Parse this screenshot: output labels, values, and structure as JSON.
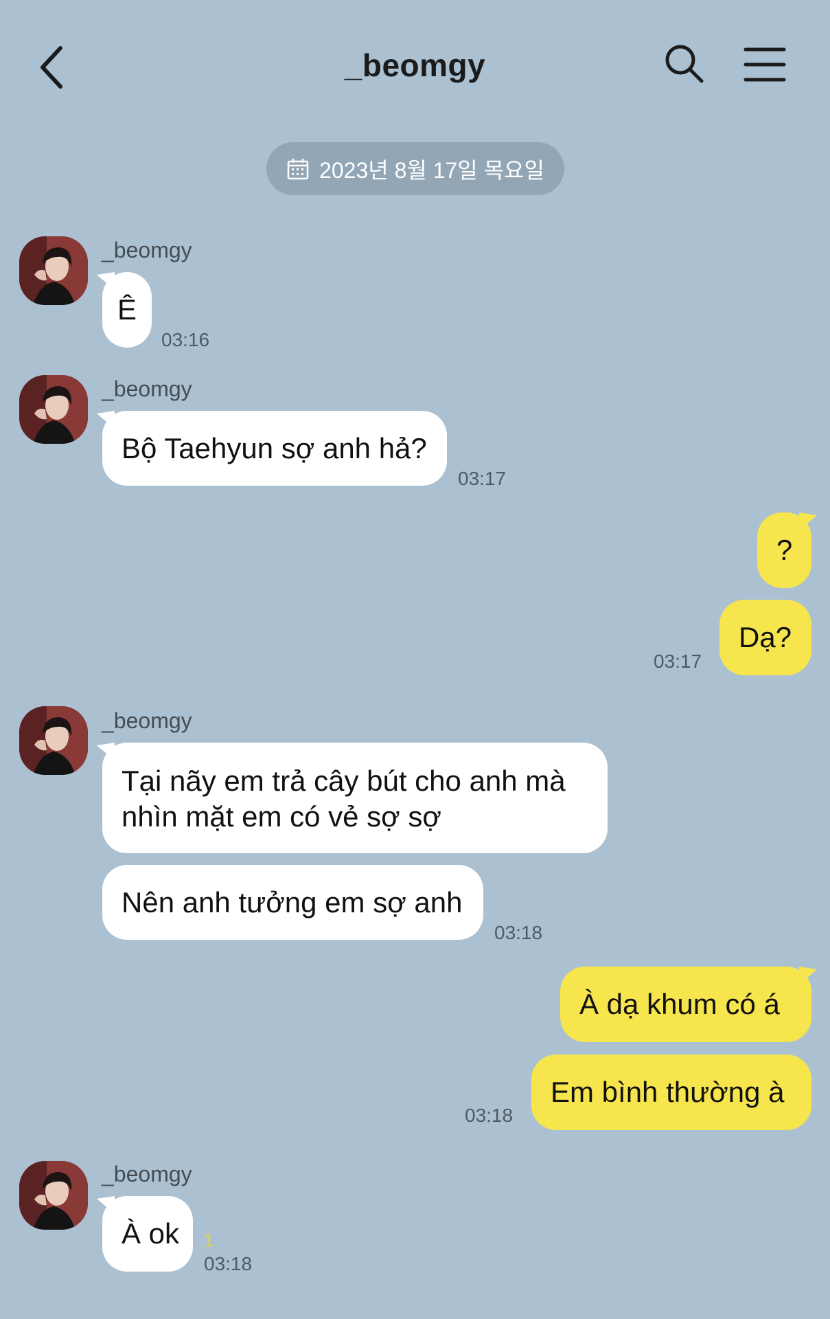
{
  "header": {
    "title": "_beomgy",
    "back_icon": "chevron-left-icon",
    "search_icon": "search-icon",
    "menu_icon": "hamburger-menu-icon"
  },
  "date_separator": {
    "icon": "calendar-icon",
    "text": "2023년 8월 17일 목요일"
  },
  "messages": {
    "m1": {
      "sender": "_beomgy",
      "text": "Ê",
      "time": "03:16"
    },
    "m2": {
      "sender": "_beomgy",
      "text": "Bộ Taehyun sợ anh hả?",
      "time": "03:17"
    },
    "m3": {
      "text": "?"
    },
    "m4": {
      "text": "Dạ?",
      "time": "03:17"
    },
    "m5": {
      "sender": "_beomgy",
      "line1": "Tại nãy em trả cây bút cho anh mà",
      "line2": "nhìn mặt em có vẻ sợ sợ"
    },
    "m6": {
      "text": "Nên anh tưởng em sợ anh",
      "time": "03:18"
    },
    "m7": {
      "text": "À dạ khum có á"
    },
    "m8": {
      "text": "Em bình thường à",
      "time": "03:18"
    },
    "m9": {
      "sender": "_beomgy",
      "text": "À ok",
      "unread": "1",
      "time": "03:18"
    }
  },
  "colors": {
    "background": "#abc1d1",
    "incoming_bubble": "#ffffff",
    "outgoing_bubble": "#f6e54c",
    "date_pill": "#93a6b6",
    "unread_count": "#e8d334"
  }
}
